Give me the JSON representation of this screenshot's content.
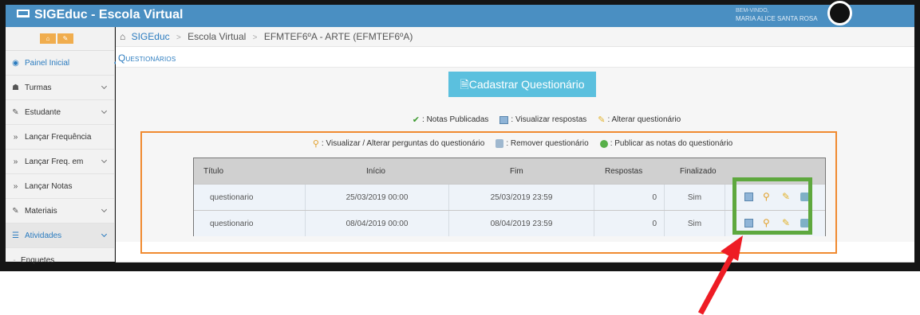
{
  "app": {
    "title": "SIGEduc - Escola Virtual"
  },
  "user": {
    "small_label": "BEM-VINDO,",
    "name": "MARIA ALICE SANTA ROSA"
  },
  "sidebar": {
    "buttons": [
      {
        "icon": "home-icon",
        "glyph": "⌂"
      },
      {
        "icon": "pencil-icon",
        "glyph": "✎"
      }
    ],
    "items": [
      {
        "label": "Painel Inicial",
        "glyph": "◉",
        "icon": "dashboard-icon"
      },
      {
        "label": "Turmas",
        "glyph": "☗",
        "icon": "users-icon"
      },
      {
        "label": "Estudante",
        "glyph": "✎",
        "icon": "edit-icon"
      },
      {
        "label": "Lançar Frequência",
        "glyph": "»",
        "icon": "chevron-double-icon"
      },
      {
        "label": "Lançar Freq. em",
        "glyph": "»",
        "icon": "chevron-double-icon"
      },
      {
        "label": "Lançar Notas",
        "glyph": "»",
        "icon": "chevron-double-icon"
      },
      {
        "label": "Materiais",
        "glyph": "✎",
        "icon": "edit-icon"
      },
      {
        "label": "Atividades",
        "glyph": "☰",
        "icon": "list-icon"
      },
      {
        "label": "Enquetes",
        "glyph": "-",
        "icon": ""
      }
    ]
  },
  "breadcrumb": [
    "SIGEduc",
    "Escola Virtual",
    "EFMTEF6ºA - ARTE (EFMTEF6ºA)"
  ],
  "page": {
    "title": "Questionários",
    "add_button": "Cadastrar Questionário",
    "add_icon": "🗎"
  },
  "legend_top": [
    {
      "glyph": "✔",
      "label": ": Notas Publicadas",
      "icon": "check-icon"
    },
    {
      "glyph": "",
      "label": ": Visualizar respostas",
      "icon": "view-responses-icon"
    },
    {
      "glyph": "✎",
      "label": ": Alterar questionário",
      "icon": "edit-questionnaire-icon"
    }
  ],
  "legend_bottom": [
    {
      "glyph": "⚲",
      "label": ": Visualizar / Alterar perguntas do questionário",
      "icon": "magnifier-icon"
    },
    {
      "glyph": "",
      "label": ": Remover questionário",
      "icon": "trash-icon"
    },
    {
      "glyph": "",
      "label": ": Publicar as notas do questionário",
      "icon": "publish-icon"
    }
  ],
  "table": {
    "headers": [
      "Título",
      "Início",
      "Fim",
      "Respostas",
      "Finalizado"
    ],
    "rows": [
      {
        "titulo": "questionario",
        "inicio": "25/03/2019 00:00",
        "fim": "25/03/2019 23:59",
        "respostas": "0",
        "finalizado": "Sim"
      },
      {
        "titulo": "questionario",
        "inicio": "08/04/2019 00:00",
        "fim": "08/04/2019 23:59",
        "respostas": "0",
        "finalizado": "Sim"
      }
    ]
  },
  "colors": {
    "topbar": "#4a8fc2",
    "accent": "#2a7bbf",
    "orange_highlight": "#f08a30",
    "green_highlight": "#5ea83e",
    "arrow": "#ee1c24"
  }
}
